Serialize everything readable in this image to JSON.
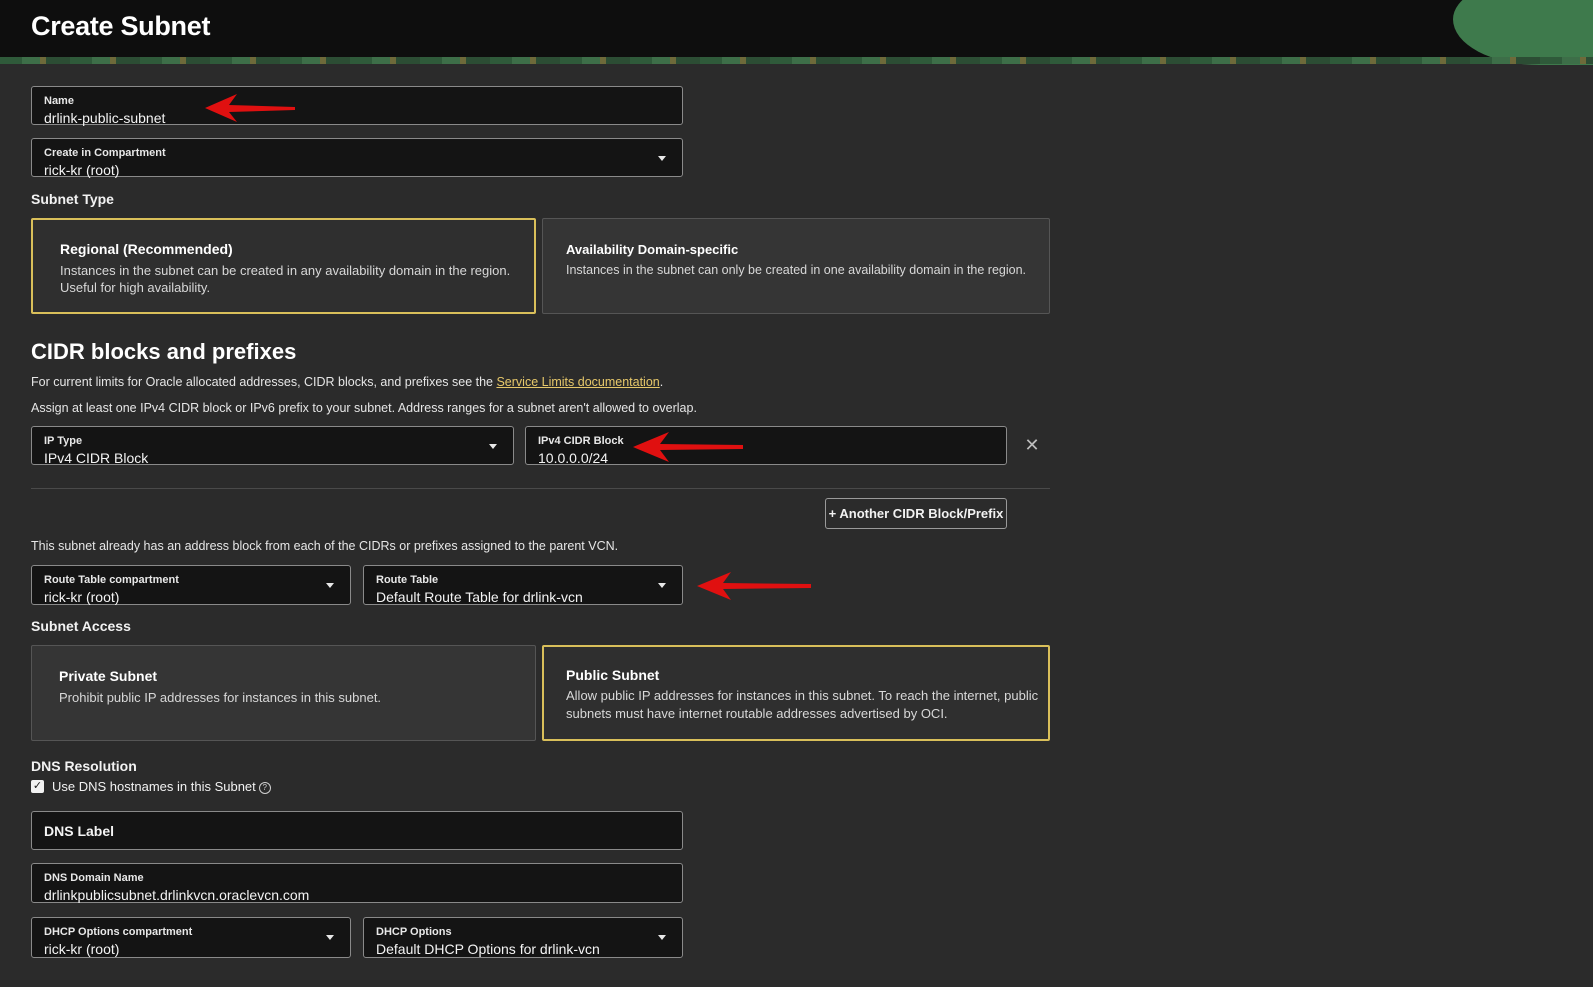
{
  "header": {
    "title": "Create Subnet"
  },
  "name_field": {
    "label": "Name",
    "value": "drlink-public-subnet"
  },
  "compartment": {
    "label": "Create in Compartment",
    "value": "rick-kr (root)"
  },
  "subnet_type": {
    "label": "Subnet Type",
    "options": [
      {
        "title": "Regional (Recommended)",
        "desc1": "Instances in the subnet can be created in any availability domain in the region.",
        "desc2": "Useful for high availability.",
        "selected": true
      },
      {
        "title": "Availability Domain-specific",
        "desc1": "Instances in the subnet can only be created in one availability domain in the region.",
        "desc2": "",
        "selected": false
      }
    ]
  },
  "cidr": {
    "heading": "CIDR blocks and prefixes",
    "limits_text": "For current limits for Oracle allocated addresses, CIDR blocks, and prefixes see the ",
    "limits_link": "Service Limits documentation",
    "limits_end": ".",
    "assign_text": "Assign at least one IPv4 CIDR block or IPv6 prefix to your subnet. Address ranges for a subnet aren't allowed to overlap.",
    "ip_type": {
      "label": "IP Type",
      "value": "IPv4 CIDR Block"
    },
    "ipv4_block": {
      "label": "IPv4 CIDR Block",
      "value": "10.0.0.0/24"
    },
    "add_button": "+ Another CIDR Block/Prefix",
    "note": "This subnet already has an address block from each of the CIDRs or prefixes assigned to the parent VCN."
  },
  "route": {
    "compartment": {
      "label": "Route Table compartment",
      "value": "rick-kr (root)"
    },
    "table": {
      "label": "Route Table",
      "value": "Default Route Table for drlink-vcn"
    }
  },
  "subnet_access": {
    "label": "Subnet Access",
    "options": [
      {
        "title": "Private Subnet",
        "desc1": "Prohibit public IP addresses for instances in this subnet.",
        "desc2": "",
        "selected": false
      },
      {
        "title": "Public Subnet",
        "desc1": "Allow public IP addresses for instances in this subnet. To reach the internet, public",
        "desc2": "subnets must have internet routable addresses advertised by OCI.",
        "selected": true
      }
    ]
  },
  "dns": {
    "label": "DNS Resolution",
    "checkbox_label": "Use DNS hostnames in this Subnet",
    "checked": true,
    "dns_label": {
      "label": "DNS Label"
    },
    "domain_name": {
      "label": "DNS Domain Name",
      "value": "drlinkpublicsubnet.drlinkvcn.oraclevcn.com"
    }
  },
  "dhcp": {
    "compartment": {
      "label": "DHCP Options compartment",
      "value": "rick-kr (root)"
    },
    "options": {
      "label": "DHCP Options",
      "value": "Default DHCP Options for drlink-vcn"
    }
  },
  "colors": {
    "accent": "#d9bf5a",
    "link": "#e7c86a",
    "annotation": "#e01010"
  }
}
